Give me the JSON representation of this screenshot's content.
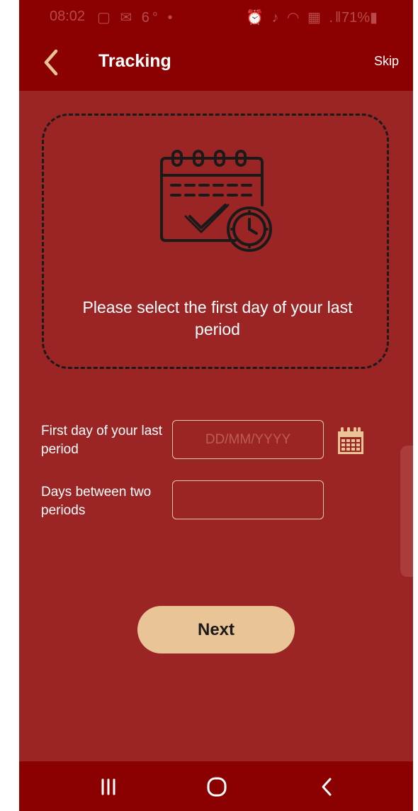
{
  "status_bar": {
    "time": "08:02",
    "left_icons": "▢ ✉ 6° •",
    "right_icons": "⏰ ♪ ◠ ▦ .‖",
    "battery": "71%▮"
  },
  "app_bar": {
    "title": "Tracking",
    "skip_label": "Skip"
  },
  "info_card": {
    "message": "Please select the first day of your last period"
  },
  "form": {
    "first_day_label": "First day of your last period",
    "first_day_placeholder": "DD/MM/YYYY",
    "first_day_value": "",
    "days_between_label": "Days between two periods",
    "days_between_value": ""
  },
  "next_label": "Next",
  "colors": {
    "background": "#9b2525",
    "bars": "#8b0000",
    "accent": "#e9c496",
    "input_border": "#f0c9a0"
  },
  "icons": {
    "back": "chevron-left-icon",
    "illustration": "calendar-check-clock-icon",
    "date_picker": "calendar-icon",
    "nav_recents": "recents-icon",
    "nav_home": "home-icon",
    "nav_back": "back-icon"
  }
}
